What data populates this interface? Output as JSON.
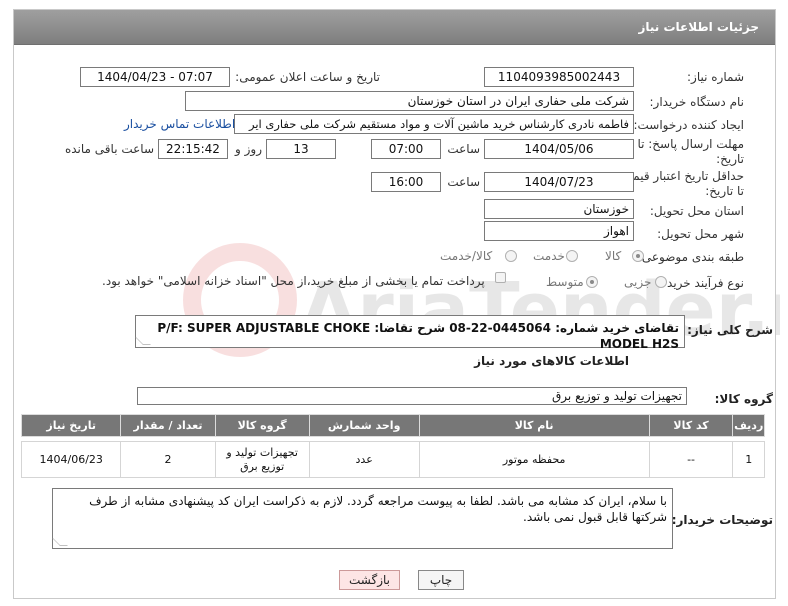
{
  "header": {
    "title": "جزئیات اطلاعات نیاز"
  },
  "need_number": {
    "label": "شماره نیاز:",
    "value": "1104093985002443"
  },
  "announce": {
    "label": "تاریخ و ساعت اعلان عمومی:",
    "value": "1404/04/23 - 07:07"
  },
  "buyer_org": {
    "label": "نام دستگاه خریدار:",
    "value": "شرکت ملی حفاری ایران در استان خوزستان"
  },
  "requester": {
    "label": "ایجاد کننده درخواست:",
    "value": "فاطمه نادری کارشناس خرید ماشین آلات و مواد مستقیم شرکت ملی حفاری ایر",
    "contact_link": "اطلاعات تماس خریدار"
  },
  "deadline": {
    "label_line1": "مهلت ارسال پاسخ: تا",
    "label_line2": "تاریخ:",
    "date": "1404/05/06",
    "time_label": "ساعت",
    "time": "07:00",
    "days": "13",
    "days_label": "روز و",
    "remaining": "22:15:42",
    "remaining_label": "ساعت باقی مانده"
  },
  "validity": {
    "label_line1": "حداقل تاریخ اعتبار قیمت:",
    "label_line2": "تا تاریخ:",
    "date": "1404/07/23",
    "time_label": "ساعت",
    "time": "16:00"
  },
  "province": {
    "label": "استان محل تحویل:",
    "value": "خوزستان"
  },
  "city": {
    "label": "شهر محل تحویل:",
    "value": "اهواز"
  },
  "category": {
    "label": "طبقه بندی موضوعی:",
    "options": [
      "کالا",
      "خدمت",
      "کالا/خدمت"
    ]
  },
  "process": {
    "label": "نوع فرآیند خرید :",
    "options": [
      "جزیی",
      "متوسط"
    ],
    "payment_note": "پرداخت تمام یا بخشی از مبلغ خرید،از محل \"اسناد خزانه اسلامی\" خواهد بود."
  },
  "description": {
    "label": "شرح کلی نیاز:",
    "value": "تقاضای خرید شماره: 0445064-22-08 شرح تقاضا: P/F: SUPER ADJUSTABLE CHOKE MODEL H2S"
  },
  "goods_info": {
    "title": "اطلاعات کالاهای مورد نیاز"
  },
  "goods_group": {
    "label": "گروه کالا:",
    "value": "تجهیزات تولید و توزیع برق"
  },
  "table": {
    "headers": [
      "ردیف",
      "کد کالا",
      "نام کالا",
      "واحد شمارش",
      "گروه کالا",
      "تعداد / مقدار",
      "تاریخ نیاز"
    ],
    "rows": [
      {
        "row": "1",
        "code": "--",
        "name": "محفظه موتور",
        "unit": "عدد",
        "group": "تجهیزات تولید و توزیع برق",
        "qty": "2",
        "date": "1404/06/23"
      }
    ]
  },
  "buyer_notes": {
    "label": "توضیحات خریدار:",
    "value": "با سلام، ایران کد مشابه می باشد. لطفا به پیوست مراجعه گردد. لازم به ذکراست ایران کد پیشنهادی مشابه از طرف شرکتها قابل قبول نمی باشد."
  },
  "buttons": {
    "print": "چاپ",
    "back": "بازگشت"
  },
  "watermark": {
    "text": "AriaTender.net"
  }
}
